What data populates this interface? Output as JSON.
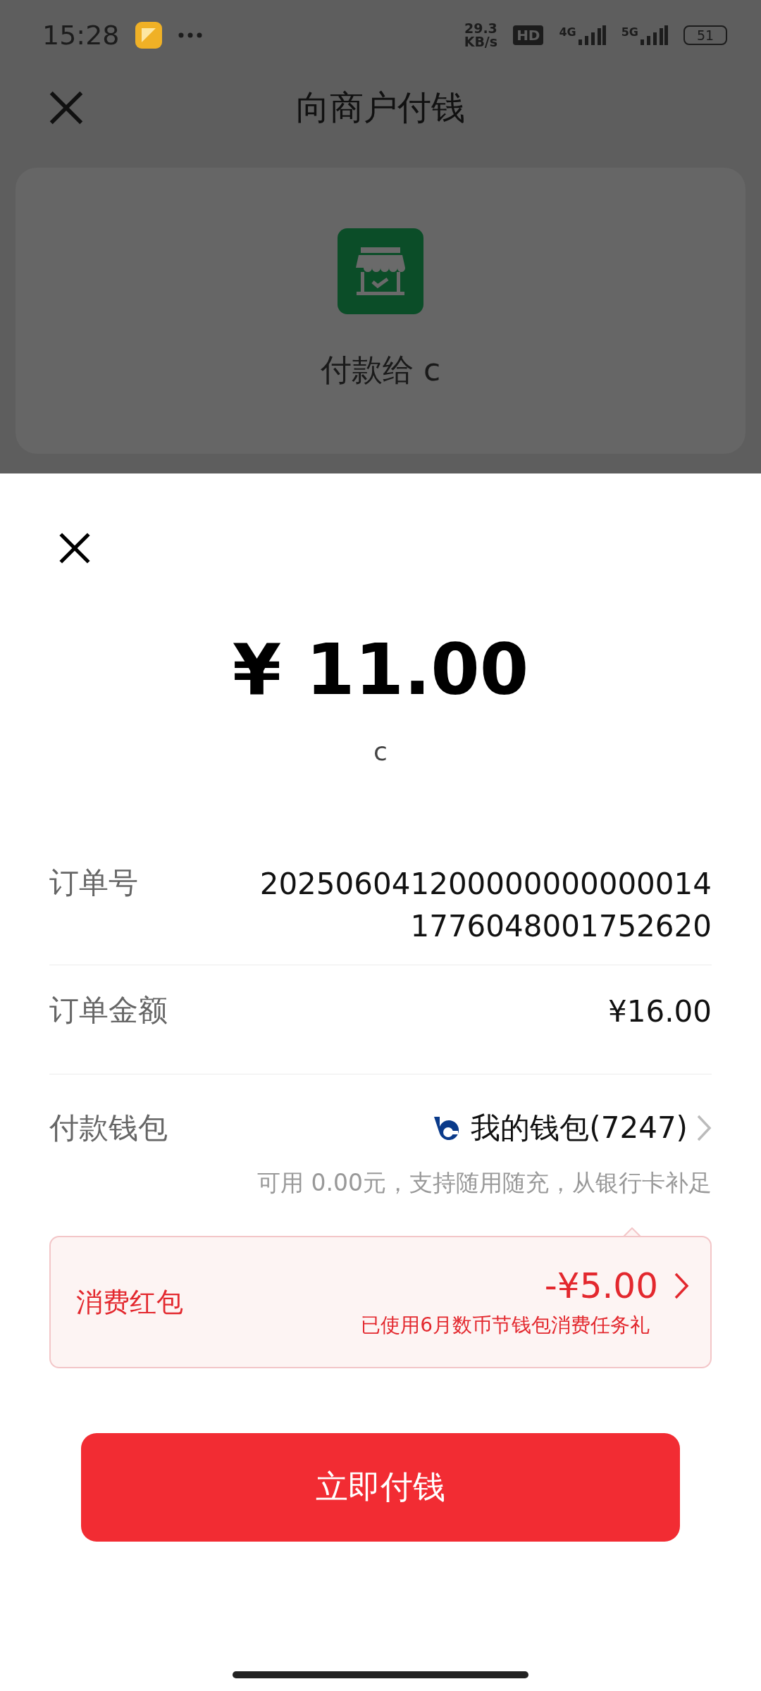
{
  "status_bar": {
    "time": "15:28",
    "net_speed_value": "29.3",
    "net_speed_unit": "KB/s",
    "hd_badge": "HD",
    "networks": [
      "4G",
      "5G"
    ],
    "battery": "51"
  },
  "header": {
    "title": "向商户付钱"
  },
  "merchant": {
    "pay_to": "付款给 c"
  },
  "sheet": {
    "amount": "¥ 11.00",
    "payee": "c",
    "details": [
      {
        "label": "订单号",
        "value_lines": [
          "202506041200000000000014",
          "1776048001752620"
        ]
      },
      {
        "label": "订单金额",
        "value_lines": [
          "¥16.00"
        ]
      }
    ],
    "wallet": {
      "label": "付款钱包",
      "name": "我的钱包(7247)",
      "note": "可用 0.00元，支持随用随充，从银行卡补足"
    },
    "red_packet": {
      "label": "消费红包",
      "amount": "-¥5.00",
      "note": "已使用6月数币节钱包消费任务礼"
    },
    "pay_button": "立即付钱"
  }
}
